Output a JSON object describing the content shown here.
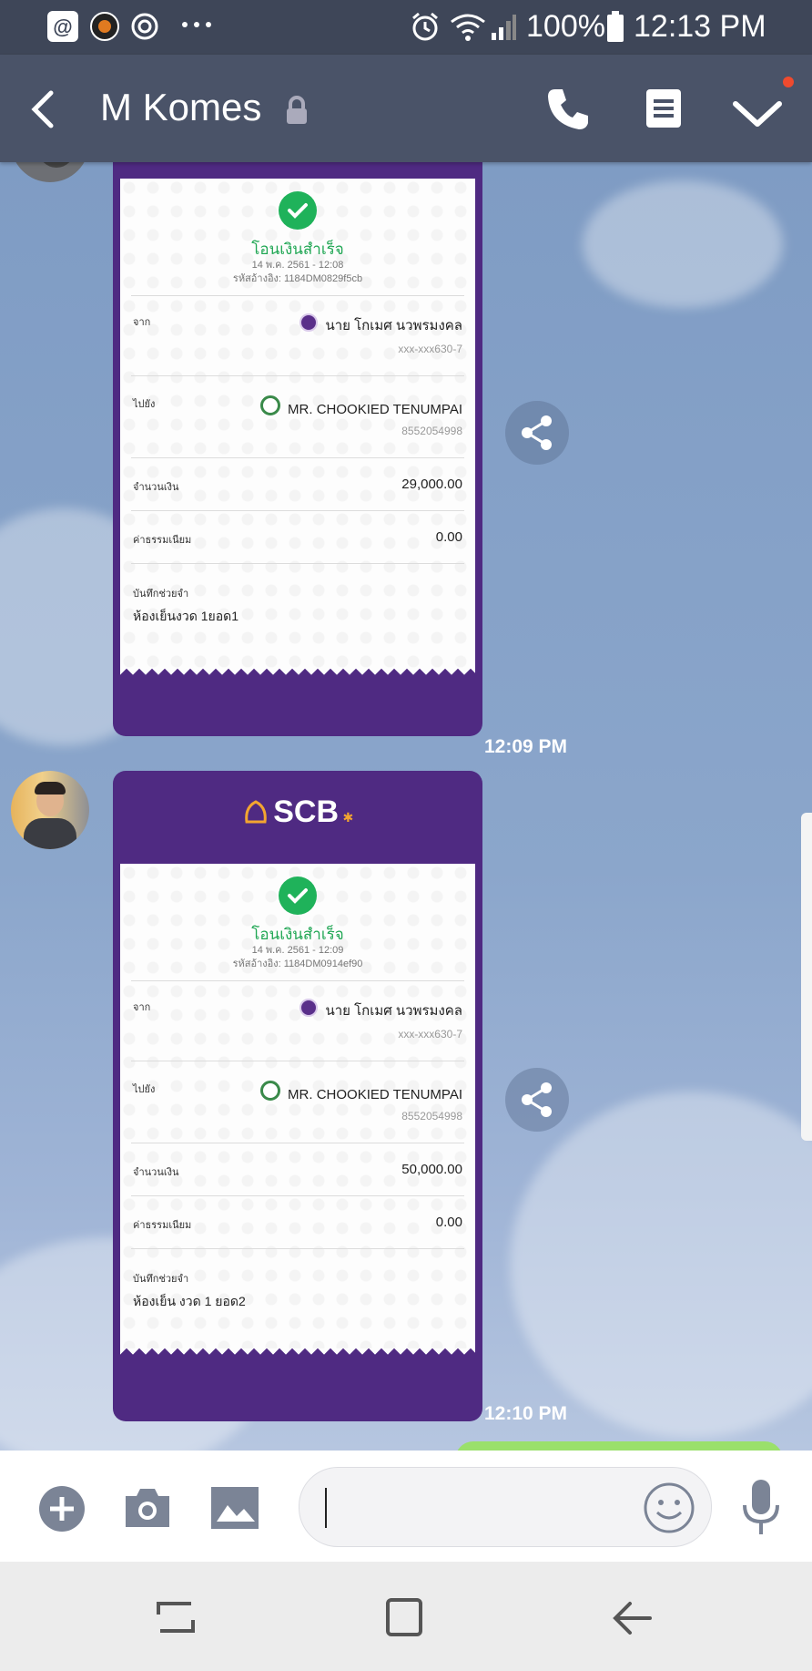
{
  "status_bar": {
    "battery": "100%",
    "time": "12:13 PM"
  },
  "header": {
    "title": "M Komes"
  },
  "messages": [
    {
      "status": "โอนเงินสำเร็จ",
      "datetime": "14 พ.ค. 2561 - 12:08",
      "ref": "รหัสอ้างอิง: 1184DM0829f5cb",
      "from_label": "จาก",
      "from_name": "นาย โกเมศ นวพรมงคล",
      "from_acct": "xxx-xxx630-7",
      "to_label": "ไปยัง",
      "to_name": "MR. CHOOKIED TENUMPAI",
      "to_acct": "8552054998",
      "amount_label": "จำนวนเงิน",
      "amount": "29,000.00",
      "fee_label": "ค่าธรรมเนียม",
      "fee": "0.00",
      "memo_label": "บันทึกช่วยจำ",
      "memo": "ห้องเย็นงวด 1ยอด1",
      "time": "12:09 PM"
    },
    {
      "bank_logo": "SCB",
      "status": "โอนเงินสำเร็จ",
      "datetime": "14 พ.ค. 2561 - 12:09",
      "ref": "รหัสอ้างอิง: 1184DM0914ef90",
      "from_label": "จาก",
      "from_name": "นาย โกเมศ นวพรมงคล",
      "from_acct": "xxx-xxx630-7",
      "to_label": "ไปยัง",
      "to_name": "MR. CHOOKIED TENUMPAI",
      "to_acct": "8552054998",
      "amount_label": "จำนวนเงิน",
      "amount": "50,000.00",
      "fee_label": "ค่าธรรมเนียม",
      "fee": "0.00",
      "memo_label": "บันทึกช่วยจำ",
      "memo": "ห้องเย็น งวด 1 ยอด2",
      "time": "12:10 PM"
    }
  ],
  "input": {
    "placeholder": ""
  },
  "colors": {
    "receipt_purple": "#4f2a82",
    "success_green": "#1fb25a",
    "header_bg": "#4a5368"
  }
}
